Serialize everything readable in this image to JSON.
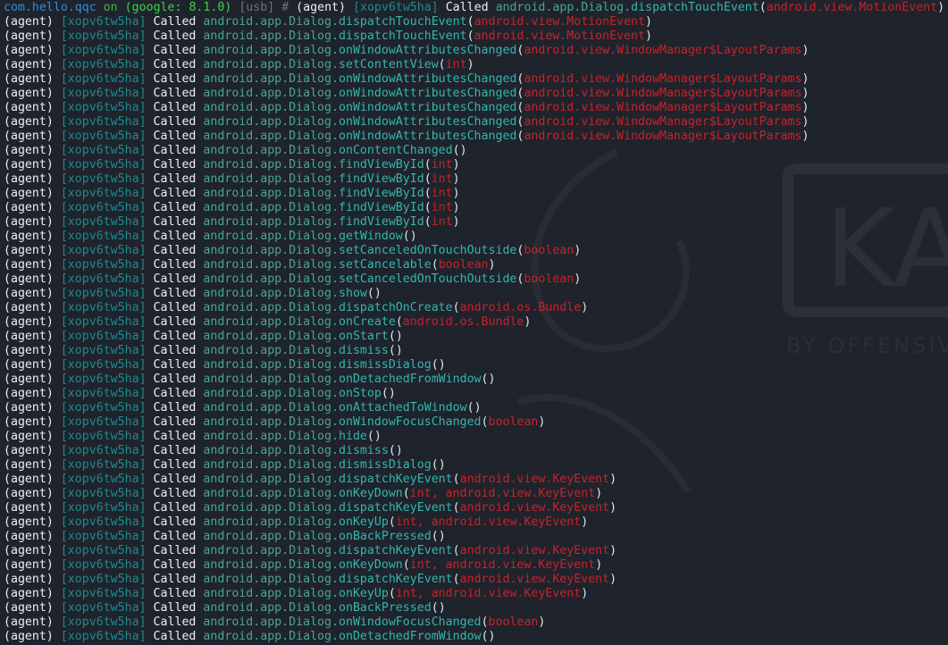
{
  "wallpaper": {
    "logo_text": "KA",
    "tagline": "BY OFFENSIV"
  },
  "prompt": {
    "package": "com.hello.qqc",
    "on": "on",
    "device": "(google: 8.1.0)",
    "transport": "[usb]",
    "hash": "#"
  },
  "agent_label": "(agent)",
  "tag": "[xopv6tw5ha]",
  "called": "Called",
  "class_prefix": "android.app.Dialog.",
  "lines": [
    {
      "method": "dispatchTouchEvent",
      "args": "android.view.MotionEvent"
    },
    {
      "method": "dispatchTouchEvent",
      "args": "android.view.MotionEvent"
    },
    {
      "method": "dispatchTouchEvent",
      "args": "android.view.MotionEvent"
    },
    {
      "method": "onWindowAttributesChanged",
      "args": "android.view.WindowManager$LayoutParams"
    },
    {
      "method": "setContentView",
      "args": "int"
    },
    {
      "method": "onWindowAttributesChanged",
      "args": "android.view.WindowManager$LayoutParams"
    },
    {
      "method": "onWindowAttributesChanged",
      "args": "android.view.WindowManager$LayoutParams"
    },
    {
      "method": "onWindowAttributesChanged",
      "args": "android.view.WindowManager$LayoutParams"
    },
    {
      "method": "onWindowAttributesChanged",
      "args": "android.view.WindowManager$LayoutParams"
    },
    {
      "method": "onWindowAttributesChanged",
      "args": "android.view.WindowManager$LayoutParams"
    },
    {
      "method": "onContentChanged",
      "args": ""
    },
    {
      "method": "findViewById",
      "args": "int"
    },
    {
      "method": "findViewById",
      "args": "int"
    },
    {
      "method": "findViewById",
      "args": "int"
    },
    {
      "method": "findViewById",
      "args": "int"
    },
    {
      "method": "findViewById",
      "args": "int"
    },
    {
      "method": "getWindow",
      "args": ""
    },
    {
      "method": "setCanceledOnTouchOutside",
      "args": "boolean"
    },
    {
      "method": "setCancelable",
      "args": "boolean"
    },
    {
      "method": "setCanceledOnTouchOutside",
      "args": "boolean"
    },
    {
      "method": "show",
      "args": ""
    },
    {
      "method": "dispatchOnCreate",
      "args": "android.os.Bundle"
    },
    {
      "method": "onCreate",
      "args": "android.os.Bundle"
    },
    {
      "method": "onStart",
      "args": ""
    },
    {
      "method": "dismiss",
      "args": ""
    },
    {
      "method": "dismissDialog",
      "args": ""
    },
    {
      "method": "onDetachedFromWindow",
      "args": ""
    },
    {
      "method": "onStop",
      "args": ""
    },
    {
      "method": "onAttachedToWindow",
      "args": ""
    },
    {
      "method": "onWindowFocusChanged",
      "args": "boolean"
    },
    {
      "method": "hide",
      "args": ""
    },
    {
      "method": "dismiss",
      "args": ""
    },
    {
      "method": "dismissDialog",
      "args": ""
    },
    {
      "method": "dispatchKeyEvent",
      "args": "android.view.KeyEvent"
    },
    {
      "method": "onKeyDown",
      "args": "int, android.view.KeyEvent"
    },
    {
      "method": "dispatchKeyEvent",
      "args": "android.view.KeyEvent"
    },
    {
      "method": "onKeyUp",
      "args": "int, android.view.KeyEvent"
    },
    {
      "method": "onBackPressed",
      "args": ""
    },
    {
      "method": "dispatchKeyEvent",
      "args": "android.view.KeyEvent"
    },
    {
      "method": "onKeyDown",
      "args": "int, android.view.KeyEvent"
    },
    {
      "method": "dispatchKeyEvent",
      "args": "android.view.KeyEvent"
    },
    {
      "method": "onKeyUp",
      "args": "int, android.view.KeyEvent"
    },
    {
      "method": "onBackPressed",
      "args": ""
    },
    {
      "method": "onWindowFocusChanged",
      "args": "boolean"
    },
    {
      "method": "onDetachedFromWindow",
      "args": ""
    }
  ],
  "colors": {
    "background": "#1f232c",
    "package": "#2f8fd8",
    "device": "#3fd24f",
    "tag": "#1f8a8e",
    "class": "#48a690",
    "method": "#33b7ac",
    "args": "#c8232a"
  }
}
